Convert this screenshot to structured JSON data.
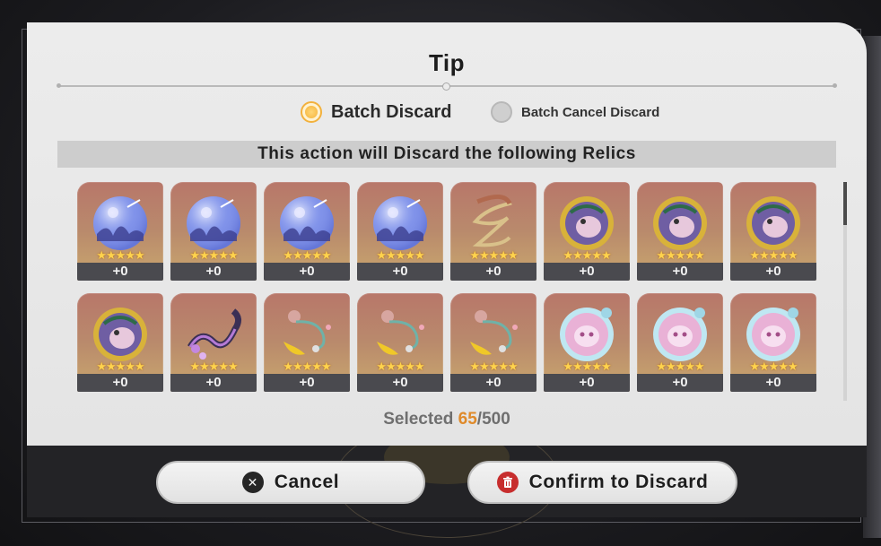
{
  "dialog": {
    "title": "Tip",
    "modes": [
      {
        "label": "Batch Discard",
        "selected": true
      },
      {
        "label": "Batch Cancel Discard",
        "selected": false
      }
    ],
    "banner": "This action will Discard the following Relics",
    "relics": [
      {
        "icon": "crystal-orb-relic-icon",
        "level": "+0",
        "stars": "★★★★★"
      },
      {
        "icon": "crystal-orb-relic-icon",
        "level": "+0",
        "stars": "★★★★★"
      },
      {
        "icon": "crystal-orb-relic-icon",
        "level": "+0",
        "stars": "★★★★★"
      },
      {
        "icon": "crystal-orb-relic-icon",
        "level": "+0",
        "stars": "★★★★★"
      },
      {
        "icon": "serpent-rope-relic-icon",
        "level": "+0",
        "stars": "★★★★★"
      },
      {
        "icon": "golden-sphere-relic-icon",
        "level": "+0",
        "stars": "★★★★★"
      },
      {
        "icon": "golden-sphere-relic-icon",
        "level": "+0",
        "stars": "★★★★★"
      },
      {
        "icon": "golden-sphere-relic-icon",
        "level": "+0",
        "stars": "★★★★★"
      },
      {
        "icon": "golden-sphere-relic-icon",
        "level": "+0",
        "stars": "★★★★★"
      },
      {
        "icon": "purple-dragon-rope-relic-icon",
        "level": "+0",
        "stars": "★★★★★"
      },
      {
        "icon": "beaded-rope-relic-icon",
        "level": "+0",
        "stars": "★★★★★"
      },
      {
        "icon": "beaded-rope-relic-icon",
        "level": "+0",
        "stars": "★★★★★"
      },
      {
        "icon": "beaded-rope-relic-icon",
        "level": "+0",
        "stars": "★★★★★"
      },
      {
        "icon": "bubble-sphere-relic-icon",
        "level": "+0",
        "stars": "★★★★★"
      },
      {
        "icon": "bubble-sphere-relic-icon",
        "level": "+0",
        "stars": "★★★★★"
      },
      {
        "icon": "bubble-sphere-relic-icon",
        "level": "+0",
        "stars": "★★★★★"
      }
    ],
    "selected_prefix": "Selected",
    "selected_count": "65",
    "selected_total": "/500",
    "cancel_label": "Cancel",
    "confirm_label": "Confirm to Discard"
  },
  "colors": {
    "accent_orange": "#df8a2a",
    "confirm_icon": "#c72d2d"
  }
}
